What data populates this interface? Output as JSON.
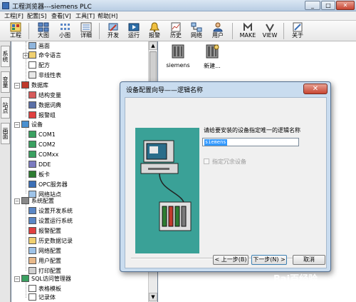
{
  "window": {
    "title": "工程浏览器---siemens PLC",
    "min_glyph": "_",
    "max_glyph": "□",
    "close_glyph": "✕"
  },
  "menu": [
    "工程[F]",
    "配置[S]",
    "查看[V]",
    "工具[T]",
    "帮助[H]"
  ],
  "toolbar": [
    {
      "label": "工程",
      "icon": "project-icon"
    },
    {
      "label": "大图",
      "icon": "large-icons-view-icon"
    },
    {
      "label": "小图",
      "icon": "small-icons-view-icon"
    },
    {
      "label": "详细",
      "icon": "details-view-icon"
    },
    {
      "label": "开发",
      "icon": "develop-icon"
    },
    {
      "label": "运行",
      "icon": "run-icon"
    },
    {
      "label": "报警",
      "icon": "alarm-icon"
    },
    {
      "label": "历史",
      "icon": "history-icon"
    },
    {
      "label": "网络",
      "icon": "network-icon"
    },
    {
      "label": "用户",
      "icon": "user-icon"
    },
    {
      "label": "MAKE",
      "icon": "make-icon"
    },
    {
      "label": "VIEW",
      "icon": "view-icon"
    },
    {
      "label": "关于",
      "icon": "about-icon"
    }
  ],
  "left_tabs": [
    "系统",
    "变量",
    "站点",
    "画面"
  ],
  "tree": [
    {
      "label": "画面"
    },
    {
      "label": "命令语言"
    },
    {
      "label": "配方"
    },
    {
      "label": "非线性表"
    },
    {
      "label": "数据库"
    },
    {
      "label": "结构变量"
    },
    {
      "label": "数据词典"
    },
    {
      "label": "报警组"
    },
    {
      "label": "设备"
    },
    {
      "label": "COM1"
    },
    {
      "label": "COM2"
    },
    {
      "label": "COMxx"
    },
    {
      "label": "DDE"
    },
    {
      "label": "板卡"
    },
    {
      "label": "OPC服务器"
    },
    {
      "label": "网络站点"
    },
    {
      "label": "系统配置"
    },
    {
      "label": "设置开发系统"
    },
    {
      "label": "设置运行系统"
    },
    {
      "label": "报警配置"
    },
    {
      "label": "历史数据记录"
    },
    {
      "label": "网络配置"
    },
    {
      "label": "用户配置"
    },
    {
      "label": "打印配置"
    },
    {
      "label": "SQL访问管理器"
    },
    {
      "label": "表格模板"
    },
    {
      "label": "记录体"
    }
  ],
  "expander_glyphs": {
    "plus": "+",
    "minus": "−"
  },
  "scroll_glyphs": {
    "up": "▲",
    "down": "▼"
  },
  "devices": [
    {
      "label": "siemens",
      "icon": "plc-device-icon"
    },
    {
      "label": "新建...",
      "icon": "new-device-icon"
    }
  ],
  "dialog": {
    "title": "设备配置向导——逻辑名称",
    "close_glyph": "✕",
    "prompt": "请给要安装的设备指定唯一的逻辑名称",
    "name_value": "siemens",
    "redundant_label": "指定冗余设备",
    "prev_button": "< 上一步(B)",
    "next_button": "下一步(N) >",
    "cancel_button": "取消"
  },
  "watermark": {
    "logo": "Bai百经验",
    "url": "jingyan.baidu.com"
  },
  "colors": {
    "dialog_image_bg": "#3aa197",
    "selection": "#3399ff",
    "desktop": "#6d7f95"
  }
}
